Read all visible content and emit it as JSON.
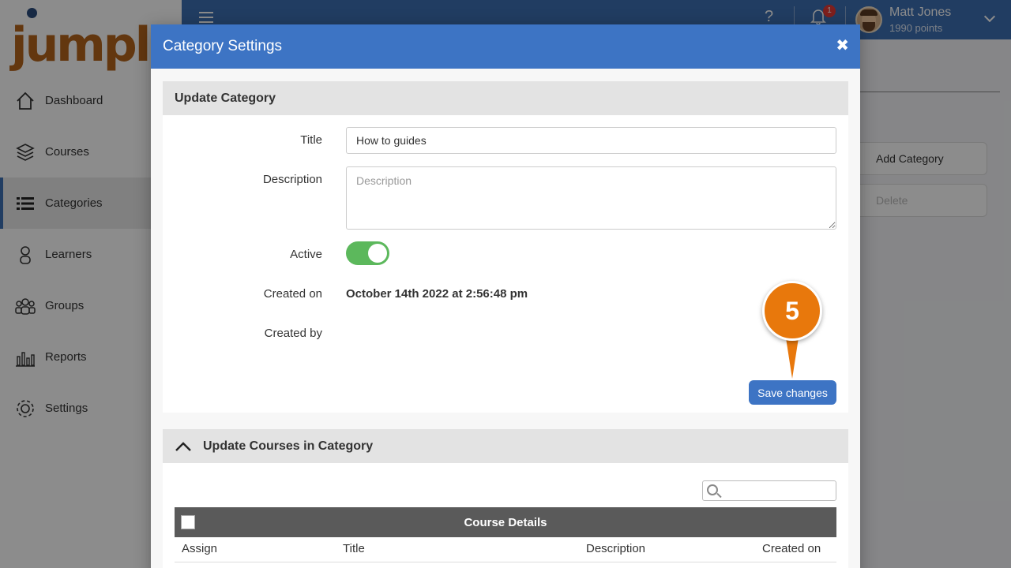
{
  "app": {
    "brand": "jumplms",
    "user": {
      "name": "Matt Jones",
      "points": "1990 points"
    },
    "notifications_count": "1"
  },
  "sidebar": {
    "items": [
      {
        "label": "Dashboard",
        "icon": "home-icon",
        "active": false
      },
      {
        "label": "Courses",
        "icon": "stack-icon",
        "active": false
      },
      {
        "label": "Categories",
        "icon": "list-icon",
        "active": true
      },
      {
        "label": "Learners",
        "icon": "person-icon",
        "active": false
      },
      {
        "label": "Groups",
        "icon": "group-icon",
        "active": false
      },
      {
        "label": "Reports",
        "icon": "bar-chart-icon",
        "active": false
      },
      {
        "label": "Settings",
        "icon": "gear-icon",
        "active": false
      }
    ]
  },
  "background_actions": {
    "add_category": "Add Category",
    "delete": "Delete"
  },
  "modal": {
    "title": "Category Settings",
    "update_category": {
      "heading": "Update Category",
      "title_label": "Title",
      "title_value": "How to guides",
      "description_label": "Description",
      "description_placeholder": "Description",
      "active_label": "Active",
      "active_value": true,
      "created_on_label": "Created on",
      "created_on_value": "October 14th 2022 at 2:56:48 pm",
      "created_by_label": "Created by",
      "save_label": "Save changes"
    },
    "callout_number": "5",
    "update_courses": {
      "heading": "Update Courses in Category",
      "table_title": "Course Details",
      "columns": [
        "Assign",
        "Title",
        "Description",
        "Created on"
      ]
    }
  },
  "colors": {
    "primary": "#3d74c4",
    "toggle_on": "#5cb85c",
    "callout": "#e8780c",
    "logo": "#b5651d"
  }
}
